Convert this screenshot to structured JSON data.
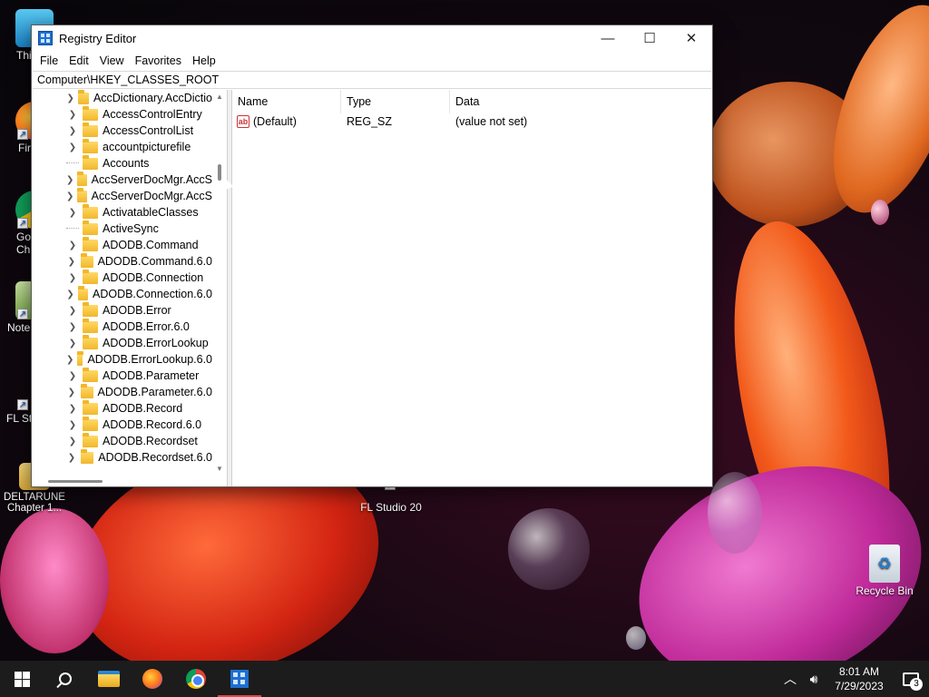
{
  "window": {
    "title": "Registry Editor",
    "menu": [
      "File",
      "Edit",
      "View",
      "Favorites",
      "Help"
    ],
    "address": "Computer\\HKEY_CLASSES_ROOT"
  },
  "tree": {
    "items": [
      {
        "label": "AccDictionary.AccDictio",
        "expandable": true
      },
      {
        "label": "AccessControlEntry",
        "expandable": true
      },
      {
        "label": "AccessControlList",
        "expandable": true
      },
      {
        "label": "accountpicturefile",
        "expandable": true
      },
      {
        "label": "Accounts",
        "expandable": false
      },
      {
        "label": "AccServerDocMgr.AccS",
        "expandable": true
      },
      {
        "label": "AccServerDocMgr.AccS",
        "expandable": true
      },
      {
        "label": "ActivatableClasses",
        "expandable": true
      },
      {
        "label": "ActiveSync",
        "expandable": false
      },
      {
        "label": "ADODB.Command",
        "expandable": true
      },
      {
        "label": "ADODB.Command.6.0",
        "expandable": true
      },
      {
        "label": "ADODB.Connection",
        "expandable": true
      },
      {
        "label": "ADODB.Connection.6.0",
        "expandable": true
      },
      {
        "label": "ADODB.Error",
        "expandable": true
      },
      {
        "label": "ADODB.Error.6.0",
        "expandable": true
      },
      {
        "label": "ADODB.ErrorLookup",
        "expandable": true
      },
      {
        "label": "ADODB.ErrorLookup.6.0",
        "expandable": true
      },
      {
        "label": "ADODB.Parameter",
        "expandable": true
      },
      {
        "label": "ADODB.Parameter.6.0",
        "expandable": true
      },
      {
        "label": "ADODB.Record",
        "expandable": true
      },
      {
        "label": "ADODB.Record.6.0",
        "expandable": true
      },
      {
        "label": "ADODB.Recordset",
        "expandable": true
      },
      {
        "label": "ADODB.Recordset.6.0",
        "expandable": true
      }
    ]
  },
  "list": {
    "columns": {
      "name": "Name",
      "type": "Type",
      "data": "Data"
    },
    "rows": [
      {
        "name": "(Default)",
        "type": "REG_SZ",
        "data": "(value not set)",
        "icon": "ab-string-icon"
      }
    ]
  },
  "desktop": {
    "icons": [
      {
        "label": "Thi",
        "name": "this-pc-icon"
      },
      {
        "label": "Fir",
        "name": "firefox-icon"
      },
      {
        "label": "Go Chr",
        "name": "chrome-icon"
      },
      {
        "label": "Note",
        "name": "notepad-icon"
      },
      {
        "label": "FL St",
        "name": "fl-studio-icon"
      },
      {
        "label": "DELTARUNE Chapter 1...",
        "name": "deltarune-icon"
      },
      {
        "label": "FL Studio 20",
        "name": "fl-studio-20-icon"
      },
      {
        "label": "Recycle Bin",
        "name": "recycle-bin-icon"
      }
    ]
  },
  "taskbar": {
    "time": "8:01 AM",
    "date": "7/29/2023",
    "notification_count": "3",
    "accent": "#d94b4b"
  }
}
